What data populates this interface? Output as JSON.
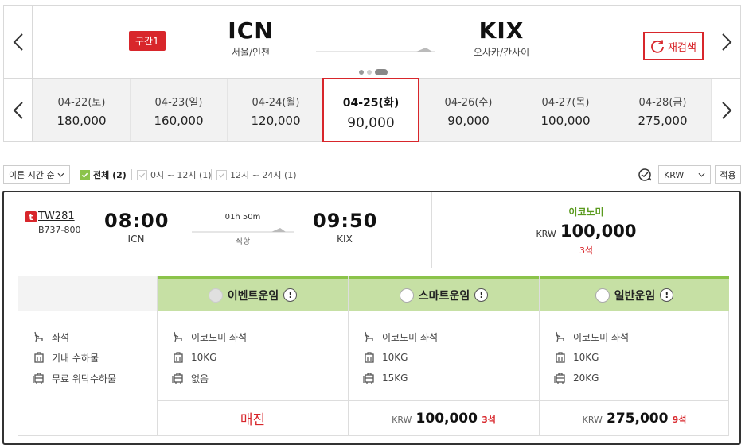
{
  "header": {
    "segment_label": "구간1",
    "departure": {
      "code": "ICN",
      "city": "서울/인천"
    },
    "arrival": {
      "code": "KIX",
      "city": "오사카/간사이"
    },
    "research_label": "재검색",
    "prev_icon": "chevron-left-icon",
    "next_icon": "chevron-right-icon"
  },
  "dates": [
    {
      "date": "04-22(토)",
      "price": "180,000"
    },
    {
      "date": "04-23(일)",
      "price": "160,000"
    },
    {
      "date": "04-24(월)",
      "price": "120,000"
    },
    {
      "date": "04-25(화)",
      "price": "90,000",
      "selected": true
    },
    {
      "date": "04-26(수)",
      "price": "90,000"
    },
    {
      "date": "04-27(목)",
      "price": "100,000"
    },
    {
      "date": "04-28(금)",
      "price": "275,000"
    }
  ],
  "filters": {
    "sort_label": "이른 시간 순",
    "all": "전체 (2)",
    "morning": "0시 ~ 12시 (1)",
    "afternoon": "12시 ~ 24시 (1)",
    "currency": "KRW",
    "apply": "적용"
  },
  "flight": {
    "airline_logo": "t",
    "flight_no": "TW281",
    "aircraft": "B737-800",
    "dep_time": "08:00",
    "dep_airport": "ICN",
    "duration": "01h 50m",
    "direct": "직항",
    "arr_time": "09:50",
    "arr_airport": "KIX",
    "class": "이코노미",
    "currency": "KRW",
    "price": "100,000",
    "seats": "3석"
  },
  "fare_table": {
    "labels": [
      "좌석",
      "기내 수하물",
      "무료 위탁수하물"
    ],
    "fares": [
      {
        "name": "이벤트운임",
        "seat": "이코노미 좌석",
        "cabin": "10KG",
        "checked": "없음",
        "soldout": "매진",
        "disabled": true
      },
      {
        "name": "스마트운임",
        "seat": "이코노미 좌석",
        "cabin": "10KG",
        "checked": "15KG",
        "currency": "KRW",
        "price": "100,000",
        "seats": "3석"
      },
      {
        "name": "일반운임",
        "seat": "이코노미 좌석",
        "cabin": "10KG",
        "checked": "20KG",
        "currency": "KRW",
        "price": "275,000",
        "seats": "9석"
      }
    ],
    "info_glyph": "!"
  },
  "colors": {
    "accent": "#d8262b",
    "green": "#8bc34a",
    "green_light": "#c6e0a4"
  }
}
